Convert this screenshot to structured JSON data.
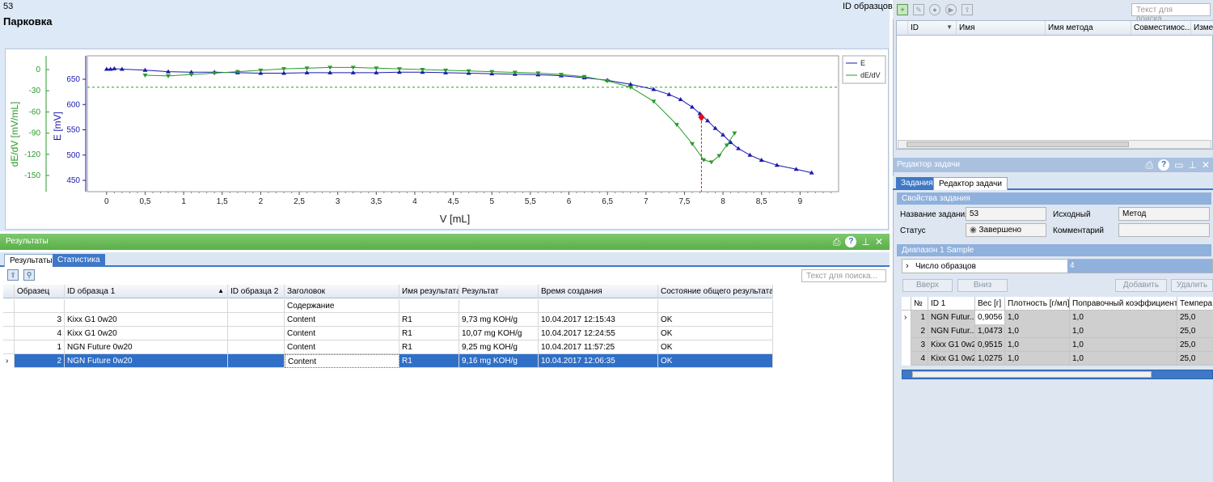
{
  "header": {
    "sample_number": "53",
    "id_samples_label": "ID образцов:",
    "title": "Парковка"
  },
  "chart_data": {
    "type": "line",
    "xlabel": "V [mL]",
    "ylabel_left_outer": "dE/dV [mV/mL]",
    "ylabel_left_inner": "E [mV]",
    "x_ticks": [
      "0",
      "0,5",
      "1",
      "1,5",
      "2",
      "2,5",
      "3",
      "3,5",
      "4",
      "4,5",
      "5",
      "5,5",
      "6",
      "6,5",
      "7",
      "7,5",
      "8",
      "8,5",
      "9"
    ],
    "E_ticks": [
      "650",
      "600",
      "550",
      "500",
      "450"
    ],
    "dEdV_ticks": [
      "0",
      "-30",
      "-60",
      "-90",
      "-120",
      "-150"
    ],
    "xlim": [
      -0.25,
      9.5
    ],
    "E_lim": [
      430,
      675
    ],
    "colors": {
      "E": "#1a1ab0",
      "dEdV": "#2a9a2a",
      "endpoint": "#e01010"
    },
    "series": [
      {
        "name": "E",
        "axis": "E",
        "x": [
          0,
          0.05,
          0.1,
          0.2,
          0.5,
          0.8,
          1.1,
          1.4,
          1.7,
          2.0,
          2.3,
          2.6,
          2.9,
          3.2,
          3.5,
          3.8,
          4.1,
          4.4,
          4.7,
          5.0,
          5.3,
          5.6,
          5.9,
          6.2,
          6.5,
          6.8,
          7.1,
          7.3,
          7.45,
          7.6,
          7.7,
          7.8,
          7.9,
          8.0,
          8.1,
          8.2,
          8.35,
          8.5,
          8.7,
          8.95,
          9.15
        ],
        "y": [
          670,
          670,
          671,
          670,
          668,
          665,
          664,
          664,
          663,
          662,
          662,
          663,
          663,
          663,
          663,
          664,
          664,
          663,
          662,
          661,
          660,
          659,
          657,
          653,
          648,
          640,
          630,
          620,
          610,
          595,
          582,
          568,
          553,
          540,
          525,
          513,
          500,
          490,
          480,
          472,
          465
        ]
      },
      {
        "name": "dE/dV",
        "axis": "dEdV",
        "x": [
          0.5,
          0.8,
          1.1,
          1.4,
          1.7,
          2.0,
          2.3,
          2.6,
          2.9,
          3.2,
          3.5,
          3.8,
          4.1,
          4.4,
          4.7,
          5.0,
          5.3,
          5.6,
          5.9,
          6.2,
          6.5,
          6.8,
          7.1,
          7.4,
          7.6,
          7.75,
          7.85,
          7.95,
          8.05,
          8.15
        ],
        "y": [
          -8,
          -9,
          -7,
          -5,
          -3,
          -1,
          1,
          2,
          3,
          3,
          2,
          1,
          0,
          -1,
          -2,
          -3,
          -4,
          -5,
          -7,
          -10,
          -16,
          -25,
          -45,
          -78,
          -105,
          -128,
          -131,
          -122,
          -107,
          -90
        ]
      }
    ],
    "endpoint": {
      "x": 7.72,
      "E": 575
    },
    "threshold_dEdV": -25,
    "legend": [
      "E",
      "dE/dV"
    ],
    "legend_position": "top-right"
  },
  "results_panel": {
    "title": "Результаты",
    "tabs": [
      "Результаты",
      "Статистика"
    ],
    "search_placeholder": "Текст для поиска...",
    "columns": [
      "Образец",
      "ID образца 1",
      "ID образца 2",
      "Заголовок",
      "Имя результата",
      "Результат",
      "Время создания",
      "Состояние общего результата"
    ],
    "header_sub": "Содержание",
    "rows": [
      {
        "n": "3",
        "id1": "Kixx G1 0w20",
        "id2": "",
        "head": "Content",
        "res_name": "R1",
        "result": "9,73 mg KOH/g",
        "time": "10.04.2017 12:15:43",
        "status": "OK"
      },
      {
        "n": "4",
        "id1": "Kixx G1 0w20",
        "id2": "",
        "head": "Content",
        "res_name": "R1",
        "result": "10,07 mg KOH/g",
        "time": "10.04.2017 12:24:55",
        "status": "OK"
      },
      {
        "n": "1",
        "id1": "NGN Future 0w20",
        "id2": "",
        "head": "Content",
        "res_name": "R1",
        "result": "9,25 mg KOH/g",
        "time": "10.04.2017 11:57:25",
        "status": "OK"
      },
      {
        "n": "2",
        "id1": "NGN Future 0w20",
        "id2": "",
        "head": "Content",
        "res_name": "R1",
        "result": "9,16 mg KOH/g",
        "time": "10.04.2017 12:06:35",
        "status": "OK"
      }
    ]
  },
  "top_right": {
    "search_placeholder": "Текст для поиска...",
    "columns": [
      "ID",
      "Имя",
      "Имя метода",
      "Совместимос...",
      "Измен"
    ]
  },
  "task_editor": {
    "title": "Редактор задачи",
    "tabs": [
      "Задания",
      "Редактор задачи"
    ],
    "properties_title": "Свойства задания",
    "task_name_label": "Название задания",
    "task_name_value": "53",
    "source_label": "Исходный",
    "source_value": "Метод",
    "status_label": "Статус",
    "status_value": "Завершено",
    "comment_label": "Комментарий",
    "comment_value": "",
    "range_title": "Диапазон 1 Sample",
    "sample_count_label": "Число образцов",
    "sample_count_value": "4",
    "buttons": [
      "Вверх",
      "Вниз",
      "Добавить",
      "Удалить"
    ],
    "sample_columns": [
      "№",
      "ID 1",
      "Вес [г]",
      "Плотность [г/мл]",
      "Поправочный коэффициент",
      "Темпера"
    ],
    "samples": [
      {
        "n": "1",
        "id": "NGN Futur...",
        "w": "0,9056",
        "d": "1,0",
        "k": "1,0",
        "t": "25,0"
      },
      {
        "n": "2",
        "id": "NGN Futur...",
        "w": "1,0473",
        "d": "1,0",
        "k": "1,0",
        "t": "25,0"
      },
      {
        "n": "3",
        "id": "Kixx G1 0w20",
        "w": "0,9515",
        "d": "1,0",
        "k": "1,0",
        "t": "25,0"
      },
      {
        "n": "4",
        "id": "Kixx G1 0w20",
        "w": "1,0275",
        "d": "1,0",
        "k": "1,0",
        "t": "25,0"
      }
    ]
  }
}
